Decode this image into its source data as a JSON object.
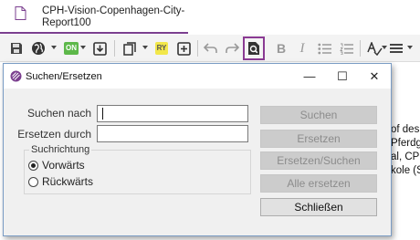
{
  "app": {
    "document_tab": {
      "title": "CPH-Vision-Copenhagen-City-Report100"
    },
    "toolbar": {
      "items": [
        {
          "name": "save",
          "icon": "save-icon"
        },
        {
          "name": "web",
          "icon": "globe-icon"
        },
        {
          "name": "on-badge",
          "label": "ON"
        },
        {
          "name": "import",
          "icon": "import-box-icon"
        },
        {
          "name": "copy",
          "icon": "copy-icon"
        },
        {
          "name": "ry-badge",
          "label": "RY"
        },
        {
          "name": "add",
          "icon": "add-box-icon"
        },
        {
          "name": "undo",
          "icon": "undo-icon"
        },
        {
          "name": "redo",
          "icon": "redo-icon"
        },
        {
          "name": "find",
          "icon": "find-document-icon"
        },
        {
          "name": "bold",
          "label": "B"
        },
        {
          "name": "italic",
          "label": "I"
        },
        {
          "name": "bullet-list",
          "icon": "bullet-list-icon"
        },
        {
          "name": "numbered-list",
          "icon": "numbered-list-icon"
        },
        {
          "name": "spellcheck",
          "icon": "spellcheck-icon"
        },
        {
          "name": "align",
          "icon": "align-icon"
        }
      ]
    },
    "document_text": [
      "of des",
      "Pferdg",
      "al, CPH",
      "kole (S"
    ]
  },
  "dialog": {
    "title": "Suchen/Ersetzen",
    "controls": {
      "minimize": "—",
      "maximize": "☐",
      "close": "✕"
    },
    "search_label": "Suchen nach",
    "search_value": "",
    "replace_label": "Ersetzen durch",
    "replace_value": "",
    "direction": {
      "title": "Suchrichtung",
      "options": [
        {
          "label": "Vorwärts",
          "checked": true
        },
        {
          "label": "Rückwärts",
          "checked": false
        }
      ]
    },
    "buttons": [
      {
        "label": "Suchen",
        "enabled": false
      },
      {
        "label": "Ersetzen",
        "enabled": false
      },
      {
        "label": "Ersetzen/Suchen",
        "enabled": false
      },
      {
        "label": "Alle ersetzen",
        "enabled": false
      },
      {
        "label": "Schließen",
        "enabled": true
      }
    ]
  },
  "colors": {
    "accent": "#7b3f8f",
    "dialog_border": "#7a9cc4",
    "disabled_button": "#cccccc",
    "on_badge": "#5db84a",
    "ry_badge": "#f2e74a"
  }
}
